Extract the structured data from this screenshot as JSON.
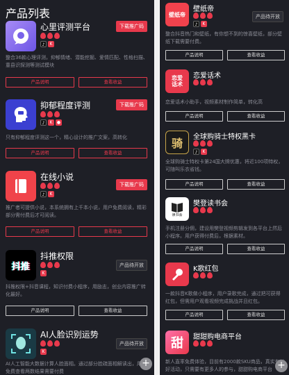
{
  "left": {
    "title": "产品列表",
    "products": [
      {
        "name": "心里评测平台",
        "action": "下载推广码",
        "action_type": "download",
        "icon": "chat-bubble-icon",
        "desc": "整合36款心理评测，抑郁情绪、潜能挖掘、爱情匹配、性格扫描、童县识探测等测试模块",
        "btn_a": "产品说明",
        "btn_b": "查看收益"
      },
      {
        "name": "抑郁程度评测",
        "action": "下载推广码",
        "action_type": "download",
        "icon": "head-profile-icon",
        "desc": "只有抑郁程度评测这一个，精心设计的推广文案，高转化",
        "btn_a": "产品说明",
        "btn_b": "查看收益"
      },
      {
        "name": "在线小说",
        "action": "下载推广码",
        "action_type": "download",
        "icon": "book-icon",
        "desc": "推广者可提供小说，本系统拥有上千本小说，用户免费阅读，精彩部分需付费后才可阅读。",
        "btn_a": "产品说明",
        "btn_b": "查看收益"
      },
      {
        "name": "抖推权限",
        "action": "产品待开放",
        "action_type": "open",
        "icon": "dou-tui-logo",
        "icon_text": "抖推",
        "desc": "抖推权限+抖音课程，知识付费小程序，用励志，创业内容推广转化最好。",
        "btn_a": "产品说明",
        "btn_b": "查看收益"
      },
      {
        "name": "AI人脸识别运势",
        "action": "产品待开放",
        "action_type": "open",
        "icon": "face-scan-icon",
        "desc": "AI人工智能大数据计算人脸面相。通过部分脸疏面相解读出，用户免费查看两数结果需要付费",
        "btn_a": "产品说明",
        "btn_b": "查看收益"
      }
    ]
  },
  "right": {
    "products": [
      {
        "name": "壁纸帝",
        "action": "产品待开放",
        "icon": "wallpaper-logo",
        "icon_text": "壁纸帝",
        "desc": "整合抖音热门和壁纸，有你想不到的惊喜壁纸，部分壁纸下载需要付费。",
        "btn_a": "产品说明",
        "btn_b": "查看收益"
      },
      {
        "name": "恋爱话术",
        "action": "",
        "icon": "love-words-logo",
        "icon_text": "恋爱话术",
        "desc": "恋爱话术小助手，视频素材制作简单，转化高",
        "btn_a": "产品说明",
        "btn_b": "查看收益"
      },
      {
        "name": "全球购骑士特权黑卡",
        "action": "",
        "icon": "knight-card-logo",
        "icon_text": "骑",
        "desc": "全球购骑士特权卡第24国大牌优惠，将近100项特权，可随叫乐衣省钱。",
        "btn_a": "产品说明",
        "btn_b": "查看收益"
      },
      {
        "name": "樊登读书会",
        "action": "",
        "icon": "book-club-logo",
        "icon_text": "读书会",
        "desc": "手机注册分佣，建设用樊登视频剪辑发到各平台上然后小程序。用户获得付费后，根据素材。",
        "btn_a": "产品说明",
        "btn_b": "查看收益"
      },
      {
        "name": "K歌红包",
        "action": "",
        "icon": "microphone-icon",
        "desc": "一款抖音K歌做小程序，用户录歌完成，通过把可获得红包，但需用户观看视频完成挑战并且红包。",
        "btn_a": "产品说明",
        "btn_b": "查看收益"
      },
      {
        "name": "甜甜购电商平台",
        "action": "",
        "icon": "tian-logo",
        "icon_text": "甜",
        "desc": "新人直率免费体验，目前有2000款SKU商品，真实有效好活动，只需要有更多人的参与，甜甜购电商平台",
        "btn_a": "产品说明",
        "btn_b": "查看收益"
      }
    ],
    "open_label": "产品待开放"
  },
  "fab_left_label": "+",
  "fab_right_label": "+"
}
